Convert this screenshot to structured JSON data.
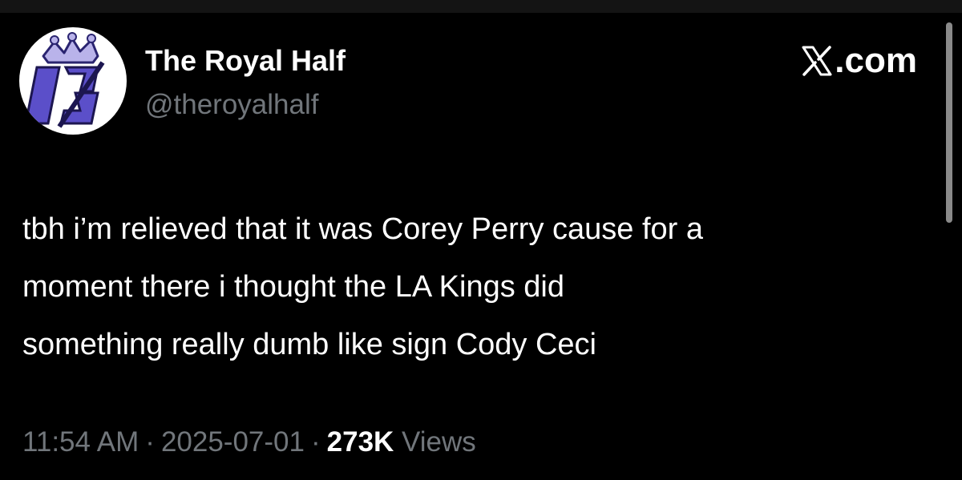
{
  "author": {
    "display_name": "The Royal Half",
    "handle": "@theroyalhalf",
    "avatar_text": "1/2",
    "avatar_icon": "crown-logo-icon"
  },
  "brand": {
    "logo_icon": "x-logo-icon",
    "domain_suffix": ".com"
  },
  "tweet": {
    "text": "tbh i’m relieved that it was Corey Perry cause for a\nmoment there i thought the LA Kings did\nsomething really dumb like sign Cody Ceci",
    "time": "11:54 AM",
    "separator": "·",
    "date": "2025-07-01",
    "views_count": "273K",
    "views_label": "Views"
  },
  "colors": {
    "background": "#000000",
    "text_primary": "#ffffff",
    "text_secondary": "#71767b",
    "avatar_accent": "#5b4fc9"
  }
}
